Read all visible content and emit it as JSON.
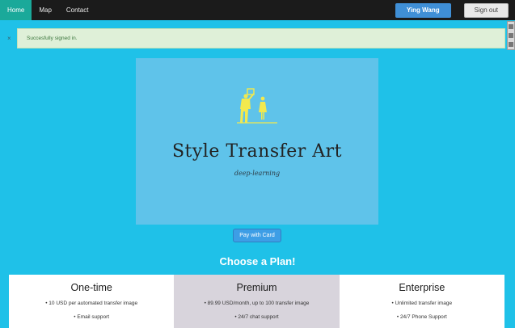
{
  "nav": {
    "items": [
      "Home",
      "Map",
      "Contact"
    ],
    "user_label": "Ying Wang",
    "signout_label": "Sign out"
  },
  "alert": {
    "close": "×",
    "text": "Succesfully signed in."
  },
  "hero": {
    "title": "Style Transfer Art",
    "subtitle": "deep-learning"
  },
  "pay_label": "Pay with Card",
  "choose_label": "Choose a Plan!",
  "plans": [
    {
      "name": "One-time",
      "features": [
        "• 10 USD per automated transfer image",
        "• Email support"
      ]
    },
    {
      "name": "Premium",
      "features": [
        "• 89.99 USD/month, up to 100 transfer image",
        "• 24/7 chat support"
      ]
    },
    {
      "name": "Enterprise",
      "features": [
        "• Unlimited transfer image",
        "• 24/7 Phone Support"
      ]
    }
  ],
  "colors": {
    "background": "#1fc1e8",
    "navbar": "#1b1b1b",
    "nav_active": "#1aa99a",
    "hero": "#5fc3ea",
    "logo": "#f2e94e",
    "alert_bg": "#dff0d8",
    "alert_text": "#3c763d",
    "featured_plan": "#d8d4dc"
  }
}
